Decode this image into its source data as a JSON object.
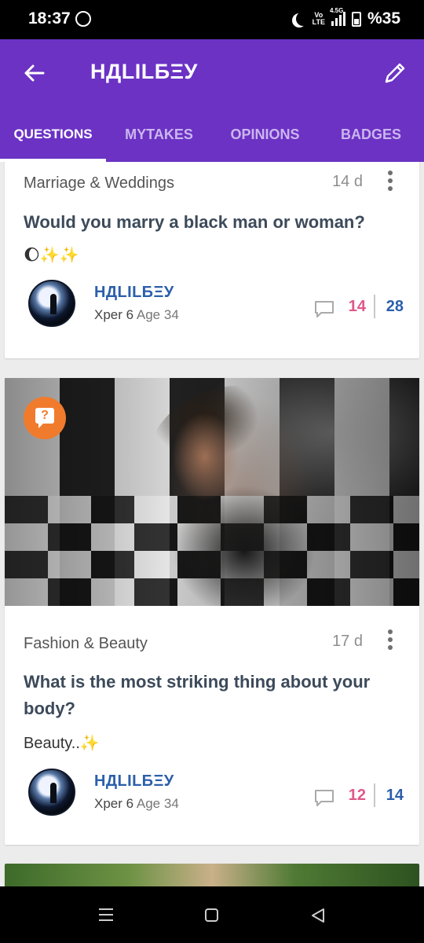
{
  "status_bar": {
    "time": "18:37",
    "volte_top": "Vo",
    "volte_bottom": "LTE",
    "network": "4.5G",
    "battery": "%35"
  },
  "header": {
    "title": "НДLILБΞУ"
  },
  "tabs": [
    {
      "label": "QUESTIONS",
      "active": true
    },
    {
      "label": "MYTAKES",
      "active": false
    },
    {
      "label": "OPINIONS",
      "active": false
    },
    {
      "label": "BADGES",
      "active": false
    }
  ],
  "posts": [
    {
      "category": "Marriage & Weddings",
      "age": "14 d",
      "title": "Would you marry a black man or woman?",
      "description": "🌔✨✨",
      "author": "НДLILБΞУ",
      "level": "Xper 6",
      "author_age": "Age 34",
      "opinions": "14",
      "votes": "28"
    },
    {
      "category": "Fashion & Beauty",
      "age": "17 d",
      "title": "What is the most striking thing about your body?",
      "description": "Beauty..✨",
      "author": "НДLILБΞУ",
      "level": "Xper 6",
      "author_age": "Age 34",
      "opinions": "12",
      "votes": "14",
      "badge_glyph": "?"
    }
  ],
  "colors": {
    "app_bar": "#6b32c4",
    "author": "#2b5fab",
    "opinions": "#e0578a",
    "question_badge": "#f07b2c"
  },
  "icons": [
    "arrow-left-icon",
    "pencil-icon",
    "more-vertical-icon",
    "comment-icon",
    "question-badge-icon",
    "menu-icon",
    "home-icon",
    "back-triangle-icon"
  ]
}
